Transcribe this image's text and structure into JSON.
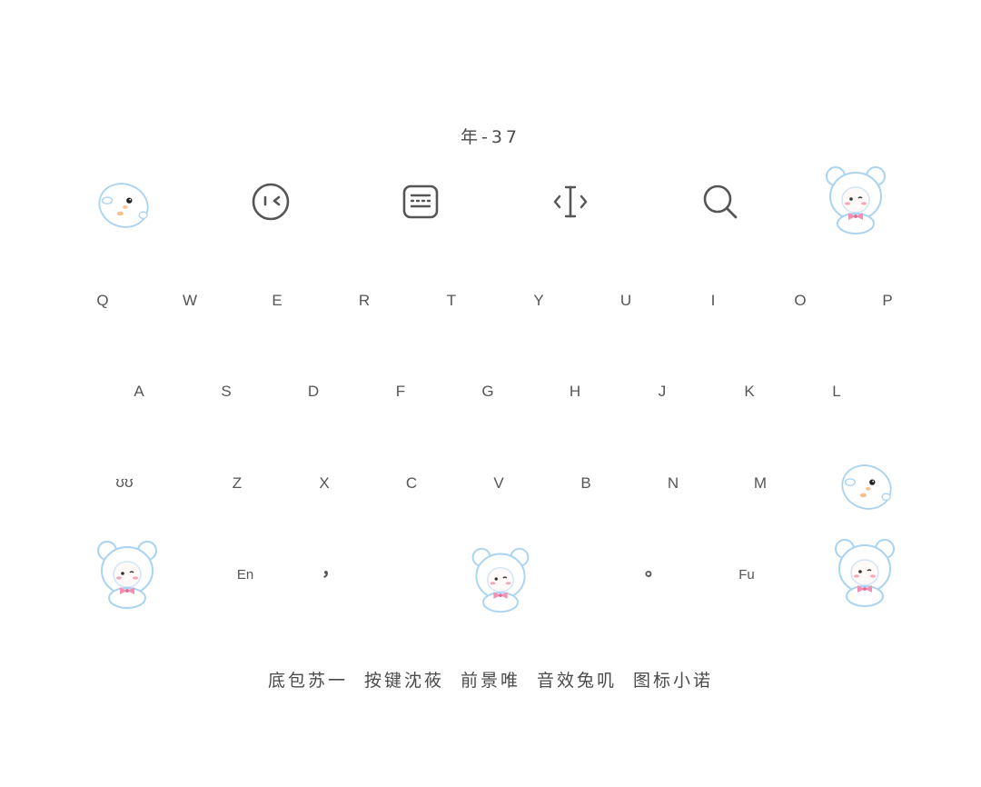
{
  "header": {
    "title": "年-37"
  },
  "toolbar": {
    "icons": [
      "seal-mascot-icon",
      "emoji-face-icon",
      "keyboard-icon",
      "text-cursor-icon",
      "search-icon",
      "bear-mascot-icon"
    ]
  },
  "keyboard": {
    "row1": [
      "Q",
      "W",
      "E",
      "R",
      "T",
      "Y",
      "U",
      "I",
      "O",
      "P"
    ],
    "row2": [
      "A",
      "S",
      "D",
      "F",
      "G",
      "H",
      "J",
      "K",
      "L"
    ],
    "row3": {
      "shift_label": "ʊʊ",
      "keys": [
        "Z",
        "X",
        "C",
        "V",
        "B",
        "N",
        "M"
      ]
    },
    "row4": {
      "en_label": "En",
      "comma_label": "，",
      "period_label": "。",
      "fu_label": "Fu"
    }
  },
  "footer": {
    "credits": [
      "底包苏一",
      "按键沈莜",
      "前景唯",
      "音效兔叽",
      "图标小诺"
    ]
  },
  "colors": {
    "text": "#4a4a4a",
    "icon": "#555555",
    "mascot_outline": "#a9d3f2",
    "mascot_blush": "#f6a6b8",
    "bow": "#f48fb1"
  }
}
